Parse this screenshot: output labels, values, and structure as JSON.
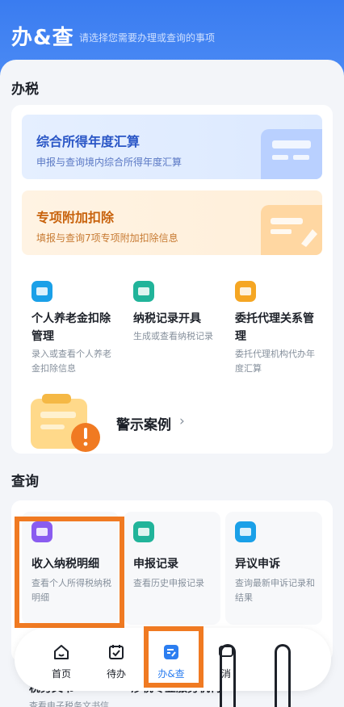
{
  "header": {
    "title": "办&查",
    "subtitle": "请选择您需要办理或查询的事项"
  },
  "tax_section": {
    "title": "办税",
    "banner_annual": {
      "title": "综合所得年度汇算",
      "subtitle": "申报与查询境内综合所得年度汇算"
    },
    "banner_deduction": {
      "title": "专项附加扣除",
      "subtitle": "填报与查询7项专项附加扣除信息"
    },
    "tiles": [
      {
        "title": "个人养老金扣除管理",
        "desc": "录入或查看个人养老金扣除信息",
        "icon": "pension-icon",
        "color": "#1aa0e8"
      },
      {
        "title": "纳税记录开具",
        "desc": "生成或查看纳税记录",
        "icon": "tax-record-icon",
        "color": "#21b49a"
      },
      {
        "title": "委托代理关系管理",
        "desc": "委托代理机构代办年度汇算",
        "icon": "agency-icon",
        "color": "#f5a623"
      }
    ],
    "warning_cases": {
      "label": "警示案例"
    }
  },
  "query_section": {
    "title": "查询",
    "tiles": [
      {
        "title": "收入纳税明细",
        "desc": "查看个人所得税纳税明细",
        "icon": "income-detail-icon",
        "color": "#8a5cf0"
      },
      {
        "title": "申报记录",
        "desc": "查看历史申报记录",
        "icon": "declaration-record-icon",
        "color": "#21b49a"
      },
      {
        "title": "异议申诉",
        "desc": "查询最新申诉记录和结果",
        "icon": "appeal-icon",
        "color": "#1aa0e8"
      }
    ],
    "behind_row": [
      {
        "title": "税务文书",
        "desc": "查看电子税务文书信"
      },
      {
        "title": "涉税专业服务机构",
        "desc": ""
      }
    ]
  },
  "tabbar": {
    "tabs": [
      {
        "label": "首页",
        "icon": "home-icon",
        "active": false
      },
      {
        "label": "待办",
        "icon": "todo-icon",
        "active": false
      },
      {
        "label": "办&查",
        "icon": "handle-query-icon",
        "active": true
      },
      {
        "label": "消",
        "icon": "message-icon",
        "active": false
      }
    ]
  },
  "colors": {
    "brand_blue": "#3a7cf0",
    "highlight_orange": "#f07a22"
  }
}
